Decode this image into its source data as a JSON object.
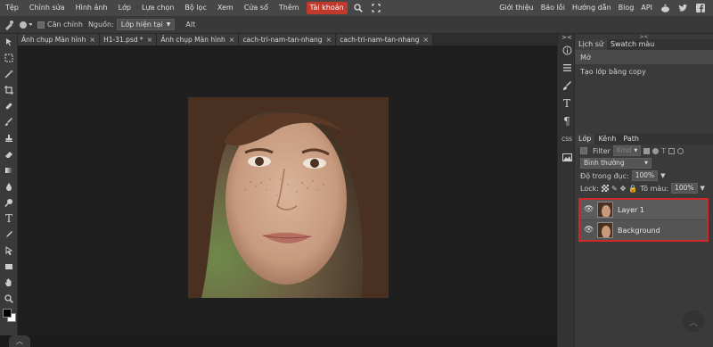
{
  "menu": {
    "items": [
      "Tệp",
      "Chỉnh sửa",
      "Hình ảnh",
      "Lớp",
      "Lựa chọn",
      "Bộ lọc",
      "Xem",
      "Cửa sổ",
      "Thêm",
      "Tài khoản"
    ],
    "right_items": [
      "Giới thiệu",
      "Báo lỗi",
      "Hướng dẫn",
      "Blog",
      "API"
    ]
  },
  "options": {
    "align_label": "Căn chỉnh",
    "source_label": "Nguồn:",
    "source_value": "Lớp hiện tại",
    "alt_label": "Alt"
  },
  "tabs": [
    {
      "label": "Ảnh chụp Màn hình"
    },
    {
      "label": "H1-31.psd *"
    },
    {
      "label": "Ảnh chụp Màn hình"
    },
    {
      "label": "cach-tri-nam-tan-nhang"
    },
    {
      "label": "cach-tri-nam-tan-nhang"
    }
  ],
  "history_panel": {
    "tabs": [
      "Lịch sử",
      "Swatch màu"
    ],
    "rows": [
      "Mở",
      "Tạo lớp bằng copy"
    ]
  },
  "layers_panel": {
    "tabs": [
      "Lớp",
      "Kênh",
      "Path"
    ],
    "filter_label": "Filter",
    "filter_value": "Kind",
    "blend_mode": "Bình thường",
    "opacity_label": "Độ trong đục:",
    "opacity_value": "100%",
    "lock_label": "Lock:",
    "fill_label": "Tô màu:",
    "fill_value": "100%",
    "layers": [
      {
        "name": "Layer 1"
      },
      {
        "name": "Background"
      }
    ]
  },
  "colors": {
    "accent": "#c0392b",
    "selection_outline": "#d02828",
    "foreground": "#000000",
    "background": "#ffffff"
  }
}
